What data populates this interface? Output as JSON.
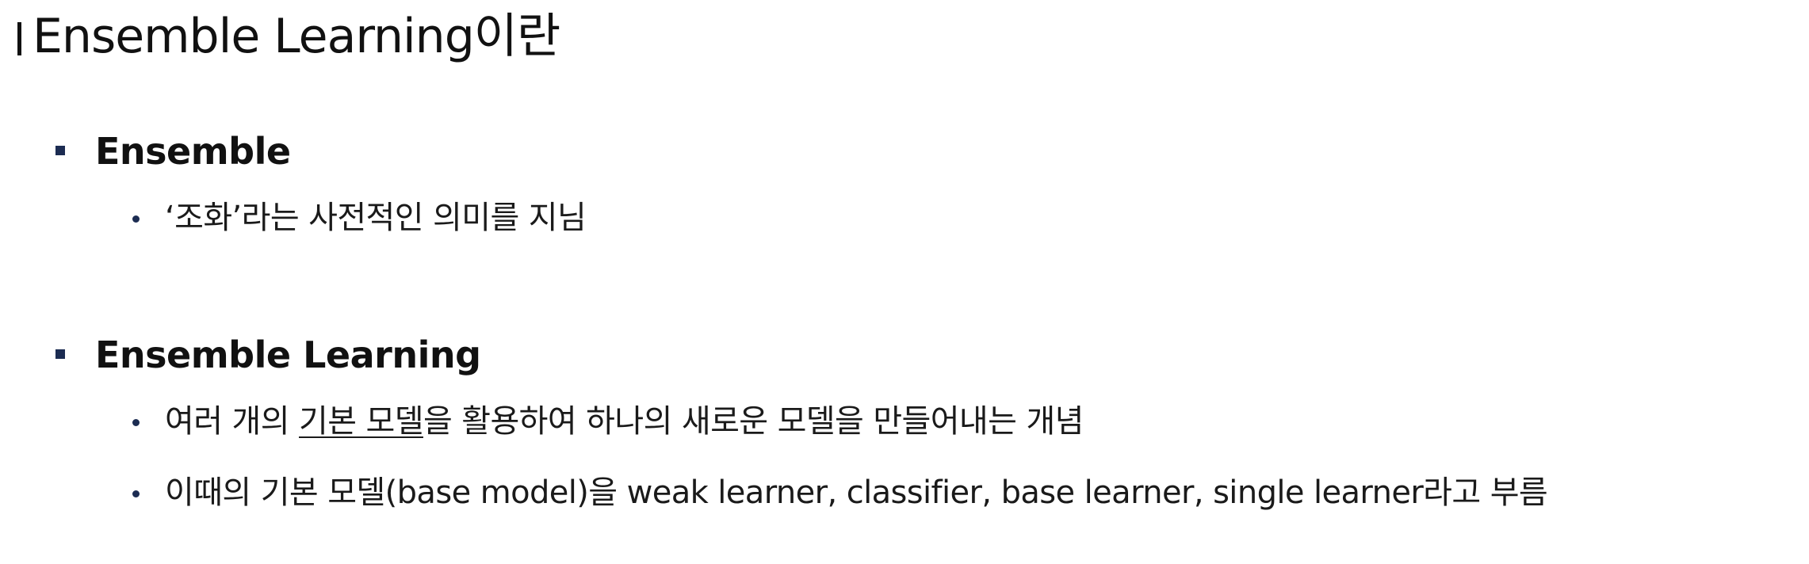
{
  "slide": {
    "title": "Ensemble Learning이란",
    "sections": [
      {
        "heading": "Ensemble",
        "items": [
          {
            "text": "‘조화’라는 사전적인 의미를 지님"
          }
        ]
      },
      {
        "heading": "Ensemble Learning",
        "items": [
          {
            "pre": "여러 개의 ",
            "underlined": "기본 모델",
            "post": "을 활용하여 하나의 새로운 모델을 만들어내는 개념"
          },
          {
            "text": "이때의 기본 모델(base model)을 weak learner, classifier, base learner, single learner라고 부름"
          }
        ]
      }
    ]
  },
  "colors": {
    "bullet": "#1c2c52",
    "text": "#111111"
  }
}
